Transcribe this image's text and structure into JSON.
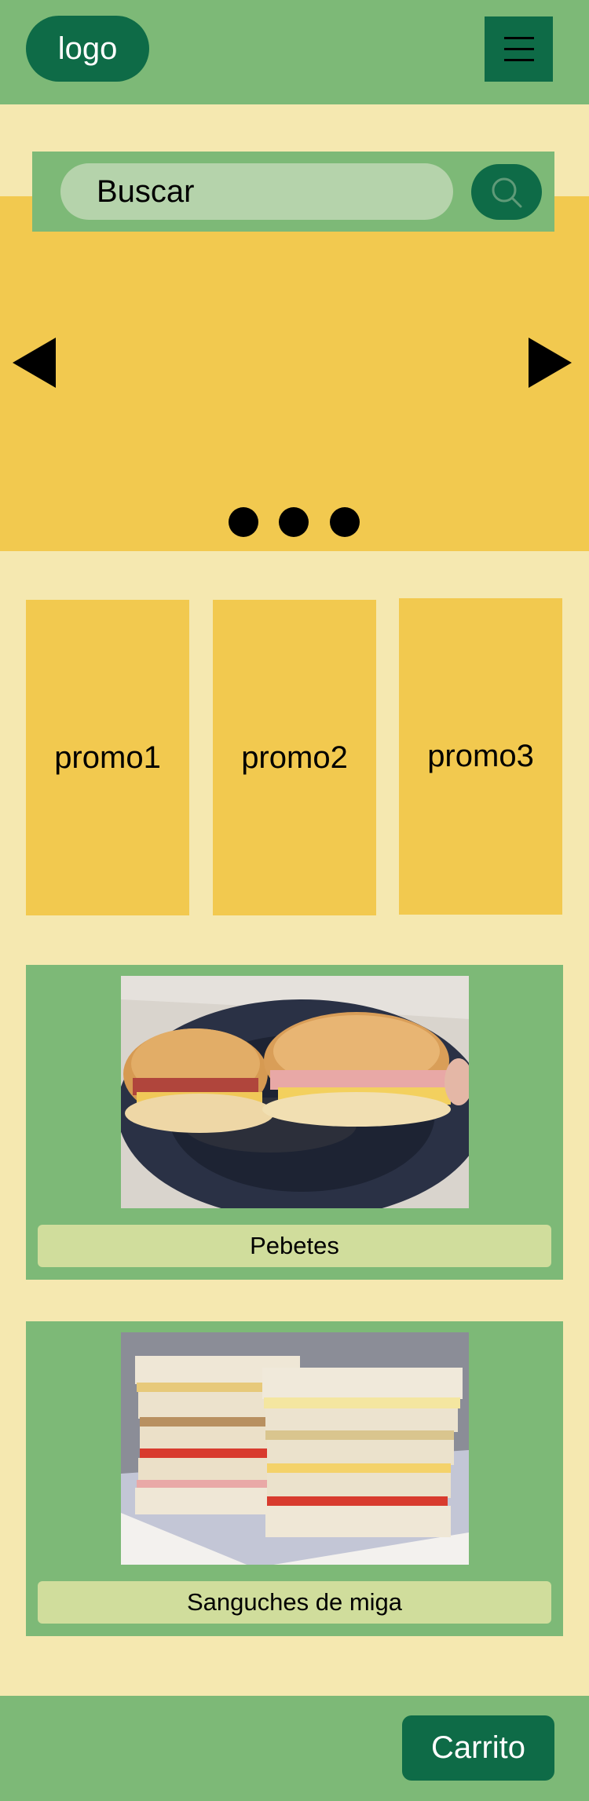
{
  "header": {
    "logo_label": "logo",
    "menu_icon": "hamburger-menu-icon"
  },
  "search": {
    "placeholder": "Buscar",
    "button_icon": "search-icon"
  },
  "carousel": {
    "prev_icon": "triangle-left-icon",
    "next_icon": "triangle-right-icon",
    "slide_count": 3
  },
  "promos": [
    {
      "label": "promo1"
    },
    {
      "label": "promo2"
    },
    {
      "label": "promo3"
    }
  ],
  "products": [
    {
      "label": "Pebetes",
      "image": "photo of pebete sandwiches on a dark plate"
    },
    {
      "label": "Sanguches de miga",
      "image": "photo of stacked crustless sandwiches on a white plate"
    }
  ],
  "footer": {
    "cart_label": "Carrito"
  },
  "colors": {
    "green": "#7db977",
    "dark_green": "#0e6b47",
    "yellow": "#f2c94f",
    "cream": "#f5e8b0",
    "search_field": "#b5d3ab",
    "label_bg": "#d0dd9c"
  }
}
